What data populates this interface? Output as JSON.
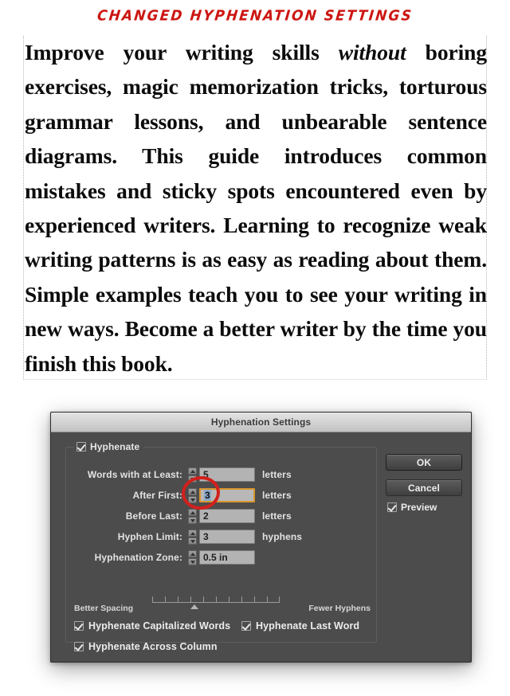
{
  "annotation": {
    "title": "Changed Hyphenation Settings",
    "highlight_color": "#d2201c",
    "circled_field": "After First"
  },
  "document": {
    "body_text_line1": "Improve your writing skills ",
    "body_text_italic": "without",
    "body_text_line2": " boring exercises, magic memorization tricks, torturous grammar lessons, and unbearable sentence diagrams. This guide introduces common mistakes and sticky spots encountered even by experienced writers. Learning to recognize weak writing patterns is as easy as reading about them. Simple examples teach you to see your writing in new ways. Become a better writer by the time you finish this book."
  },
  "dialog": {
    "title": "Hyphenation Settings",
    "group": {
      "legend_label": "Hyphenate",
      "legend_checked": true
    },
    "fields": [
      {
        "label": "Words with at Least:",
        "value": "5",
        "unit": "letters",
        "focused": false
      },
      {
        "label": "After First:",
        "value": "3",
        "unit": "letters",
        "focused": true
      },
      {
        "label": "Before Last:",
        "value": "2",
        "unit": "letters",
        "focused": false
      },
      {
        "label": "Hyphen Limit:",
        "value": "3",
        "unit": "hyphens",
        "focused": false
      },
      {
        "label": "Hyphenation Zone:",
        "value": "0.5 in",
        "unit": "",
        "focused": false
      }
    ],
    "slider": {
      "left_label": "Better Spacing",
      "right_label": "Fewer Hyphens",
      "position_percent": 30
    },
    "checkboxes": [
      {
        "label": "Hyphenate Capitalized Words",
        "checked": true
      },
      {
        "label": "Hyphenate Last Word",
        "checked": true
      },
      {
        "label": "Hyphenate Across Column",
        "checked": true
      }
    ],
    "buttons": {
      "ok_label": "OK",
      "cancel_label": "Cancel"
    },
    "preview": {
      "label": "Preview",
      "checked": true
    }
  }
}
